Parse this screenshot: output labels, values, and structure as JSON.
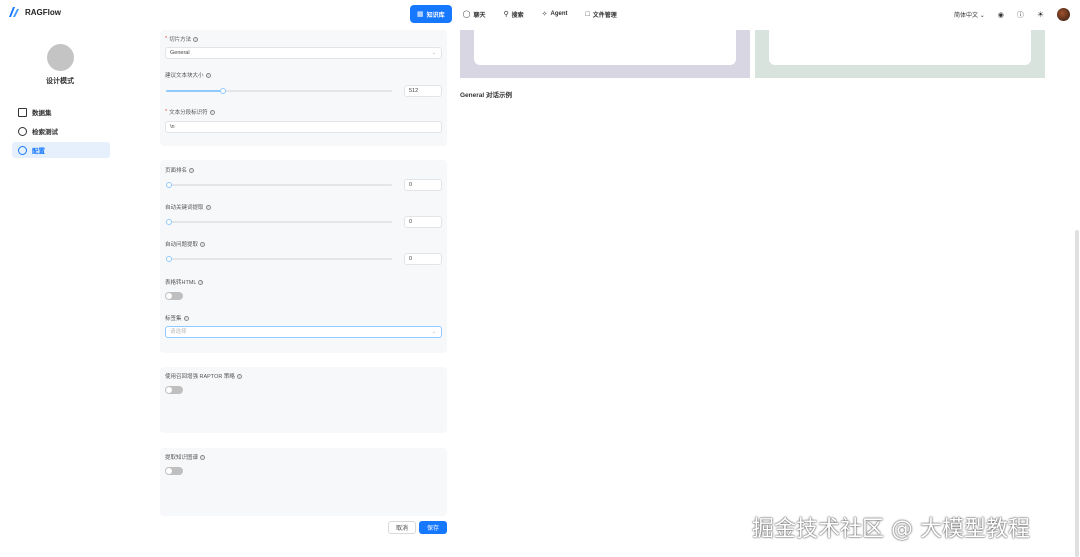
{
  "app": {
    "name": "RAGFlow",
    "accent": "#1677ff"
  },
  "nav": [
    {
      "icon": "database-icon",
      "label": "知识库",
      "active": true
    },
    {
      "icon": "chat-icon",
      "label": "聊天",
      "active": false
    },
    {
      "icon": "search-icon",
      "label": "搜索",
      "active": false
    },
    {
      "icon": "agent-icon",
      "label": "Agent",
      "active": false
    },
    {
      "icon": "folder-icon",
      "label": "文件管理",
      "active": false
    }
  ],
  "header_right": {
    "language": "简体中文"
  },
  "sidebar": {
    "kb_name": "设计模式",
    "items": [
      {
        "icon": "document-icon",
        "label": "数据集",
        "active": false
      },
      {
        "icon": "target-icon",
        "label": "检索测试",
        "active": false
      },
      {
        "icon": "settings-icon",
        "label": "配置",
        "active": true
      }
    ]
  },
  "form": {
    "chunk_method": {
      "label": "切片方法",
      "value": "General"
    },
    "chunk_size": {
      "label": "建议文本块大小",
      "value": "512",
      "fraction": 0.25
    },
    "delimiter": {
      "label": "文本分段标识符",
      "value": "\\n"
    },
    "page_rank": {
      "label": "页面排名",
      "value": "0",
      "fraction": 0
    },
    "auto_keywords": {
      "label": "自动关键词提取",
      "value": "0",
      "fraction": 0
    },
    "auto_questions": {
      "label": "自动问题提取",
      "value": "0",
      "fraction": 0
    },
    "html_to_excel": {
      "label": "表格转HTML",
      "on": false
    },
    "tags": {
      "label": "标签集",
      "placeholder": "请选择"
    },
    "raptor": {
      "label": "使用召回增强 RAPTOR 策略",
      "on": false
    },
    "knowledge_graph": {
      "label": "提取知识图谱",
      "on": false
    }
  },
  "buttons": {
    "cancel": "取消",
    "save": "保存"
  },
  "preview": {
    "title": "General 对话示例",
    "card_colors": [
      "#d9d6e3",
      "#d7e3dc"
    ]
  },
  "watermark": "掘金技术社区 @ 大模型教程"
}
